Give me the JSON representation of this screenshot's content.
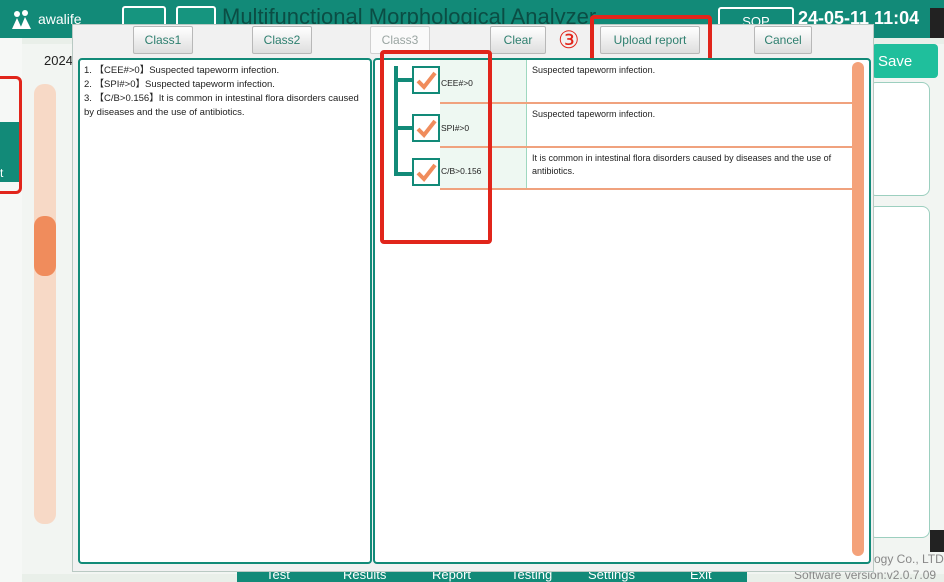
{
  "app": {
    "brand": "awalife",
    "title": "Multifunctional Morphological Analyzer",
    "sop": "SOP",
    "clock": "24-05-11 11:04",
    "date_prefix": "2024",
    "save_label": "Save",
    "left_label": "t",
    "company": "ogy Co., LTD",
    "version": "Software version:v2.0.7.09",
    "nav": [
      "Test",
      "Results",
      "Report",
      "Testing",
      "Settings",
      "Exit"
    ],
    "accent": "#128a78",
    "highlight": "#e1251b"
  },
  "dialog": {
    "tabs": [
      "Class1",
      "Class2",
      "Class3"
    ],
    "selected_tab": "Class3",
    "clear_label": "Clear",
    "step_marker": "③",
    "upload_label": "Upload report",
    "cancel_label": "Cancel",
    "report_lines": [
      "1.  【CEE#>0】Suspected tapeworm infection.",
      "2.  【SPI#>0】Suspected tapeworm infection.",
      "3.  【C/B>0.156】It is common in intestinal flora disorders caused by diseases and the use of antibiotics."
    ],
    "rules": [
      {
        "condition": "CEE#>0",
        "checked": true,
        "description": "Suspected tapeworm infection."
      },
      {
        "condition": "SPI#>0",
        "checked": true,
        "description": "Suspected tapeworm infection."
      },
      {
        "condition": "C/B>0.156",
        "checked": true,
        "description": "It is common in intestinal flora disorders caused by diseases and the use of antibiotics."
      }
    ]
  }
}
